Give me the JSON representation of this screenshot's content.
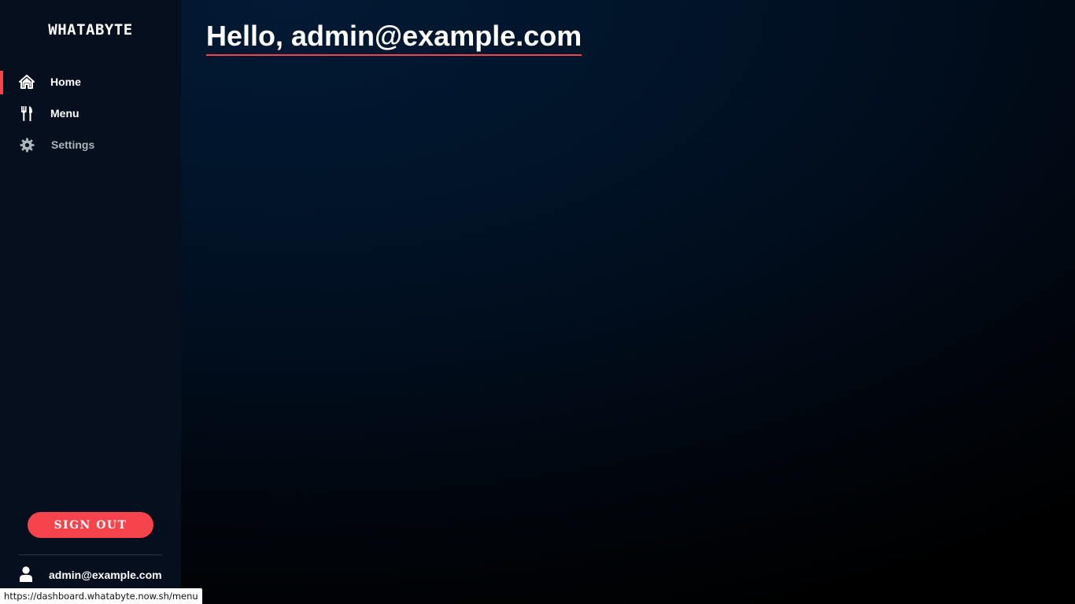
{
  "sidebar": {
    "brand": "WHATABYTE",
    "nav": [
      {
        "label": "Home",
        "icon": "home-icon",
        "active": true
      },
      {
        "label": "Menu",
        "icon": "fork-knife-icon",
        "active": false
      },
      {
        "label": "Settings",
        "icon": "gear-icon",
        "active": false
      }
    ],
    "sign_out_label": "SIGN OUT",
    "user_email": "admin@example.com",
    "user_icon": "user-icon"
  },
  "main": {
    "greeting": "Hello, admin@example.com"
  },
  "status_bar": {
    "url": "https://dashboard.whatabyte.now.sh/menu"
  },
  "colors": {
    "accent": "#f7434c",
    "sidebar_bg": "#050f1d",
    "main_bg": "#021a35",
    "text": "#ffffff",
    "muted_text": "#aeb4bd"
  }
}
